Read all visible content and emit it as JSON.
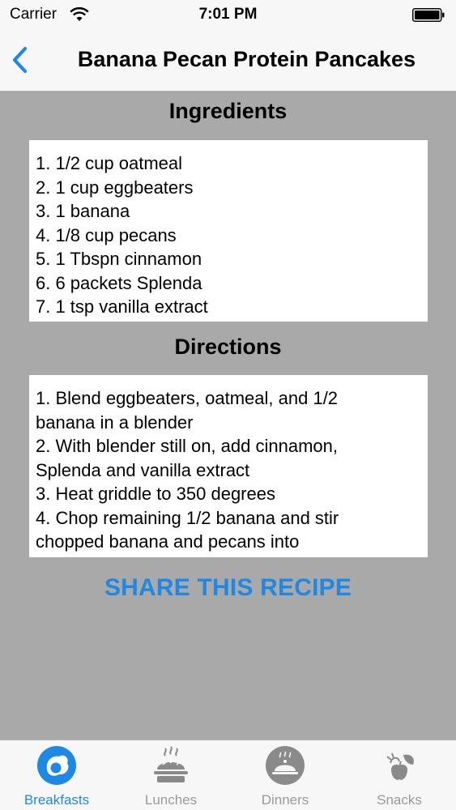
{
  "status_bar": {
    "carrier": "Carrier",
    "time": "7:01 PM"
  },
  "nav": {
    "title": "Banana Pecan Protein Pancakes"
  },
  "ingredients": {
    "heading": "Ingredients",
    "items": [
      "1. 1/2 cup oatmeal",
      "2. 1 cup eggbeaters",
      "3. 1 banana",
      "4. 1/8 cup pecans",
      "5. 1 Tbspn cinnamon",
      "6. 6 packets Splenda",
      "7. 1 tsp vanilla extract"
    ]
  },
  "directions": {
    "heading": "Directions",
    "lines": [
      "1. Blend eggbeaters, oatmeal, and 1/2",
      "banana in a blender",
      "2. With blender still on, add cinnamon,",
      "Splenda and vanilla extract",
      "3. Heat griddle to 350 degrees",
      "4. Chop remaining 1/2 banana and stir",
      "chopped banana and pecans into"
    ]
  },
  "share_label": "SHARE THIS RECIPE",
  "tabs": [
    {
      "label": "Breakfasts",
      "icon": "breakfast-icon",
      "active": true
    },
    {
      "label": "Lunches",
      "icon": "lunch-icon",
      "active": false
    },
    {
      "label": "Dinners",
      "icon": "dinner-icon",
      "active": false
    },
    {
      "label": "Snacks",
      "icon": "snack-icon",
      "active": false
    }
  ],
  "colors": {
    "accent": "#1e88e5",
    "background": "#a9a9a9",
    "bar": "#f7f7f7",
    "inactive": "#9a9a9a"
  }
}
